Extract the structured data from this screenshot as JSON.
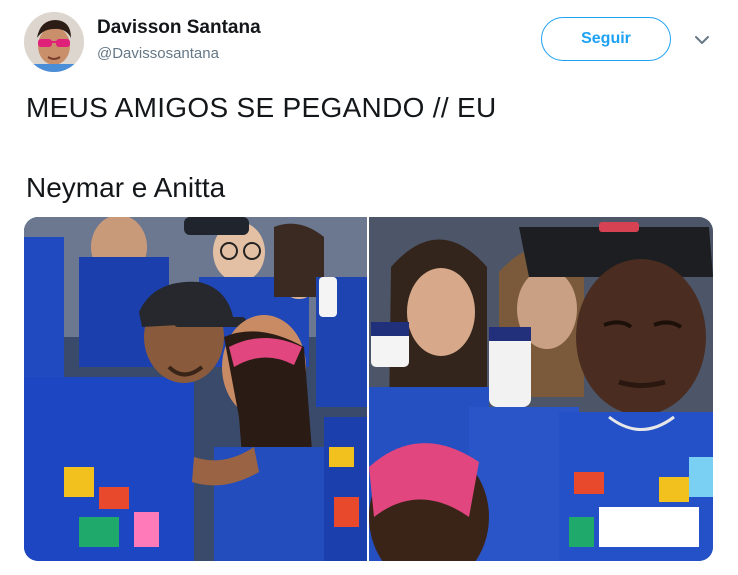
{
  "user": {
    "name": "Davisson Santana",
    "handle": "@Davissosantana"
  },
  "actions": {
    "follow_label": "Seguir",
    "caret_icon": "chevron-down-icon"
  },
  "tweet": {
    "line1": "MEUS AMIGOS SE PEGANDO // EU",
    "line2": "Neymar e Anitta"
  },
  "colors": {
    "accent": "#1da1f2",
    "secondary_text": "#657786",
    "shirt_blue": "#1f47b8"
  }
}
